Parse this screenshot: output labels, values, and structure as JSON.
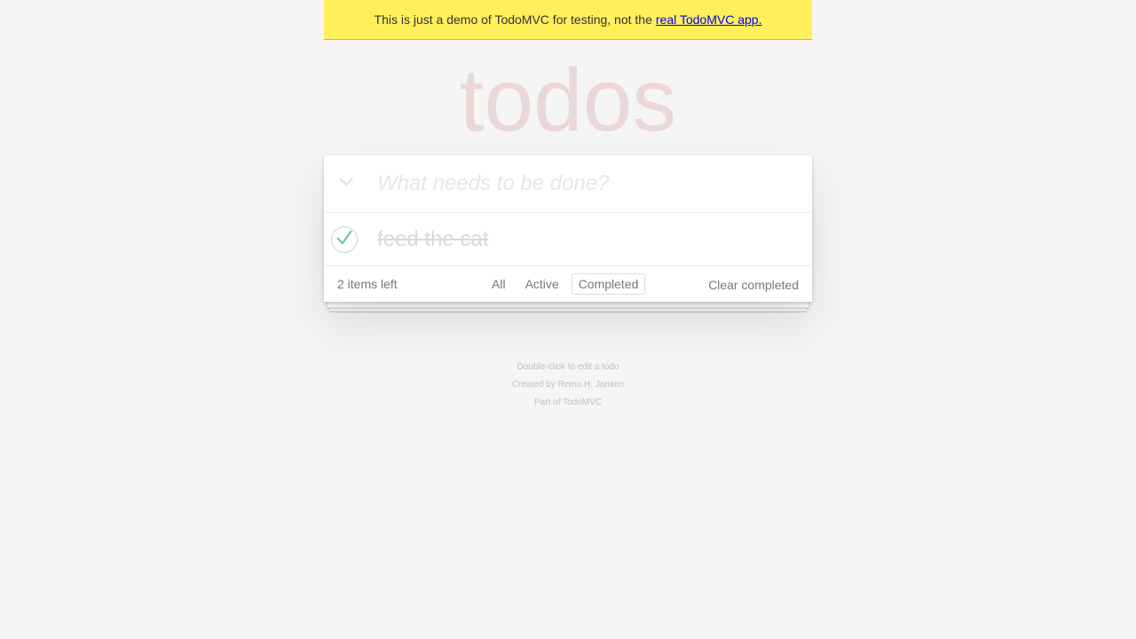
{
  "banner": {
    "text": "This is just a demo of TodoMVC for testing, not the",
    "link_text": "real TodoMVC app."
  },
  "app": {
    "title": "todos",
    "new_todo_placeholder": "What needs to be done?",
    "todos": [
      {
        "label": "feed the cat",
        "completed": true
      }
    ],
    "footer": {
      "count_text": "2 items left",
      "filters": [
        "All",
        "Active",
        "Completed"
      ],
      "selected_filter": "Completed",
      "clear_label": "Clear completed"
    }
  },
  "info": {
    "line1": "Double-click to edit a todo",
    "line2": "Created by Remo H. Jansen",
    "line3": "Part of TodoMVC"
  },
  "colors": {
    "banner_bg": "#fff05c",
    "check_green": "#5dc2af",
    "title": "rgba(175,47,47,0.15)"
  },
  "icons": {
    "toggle_all": "chevron-down-icon",
    "completed_check": "checkmark-icon"
  }
}
